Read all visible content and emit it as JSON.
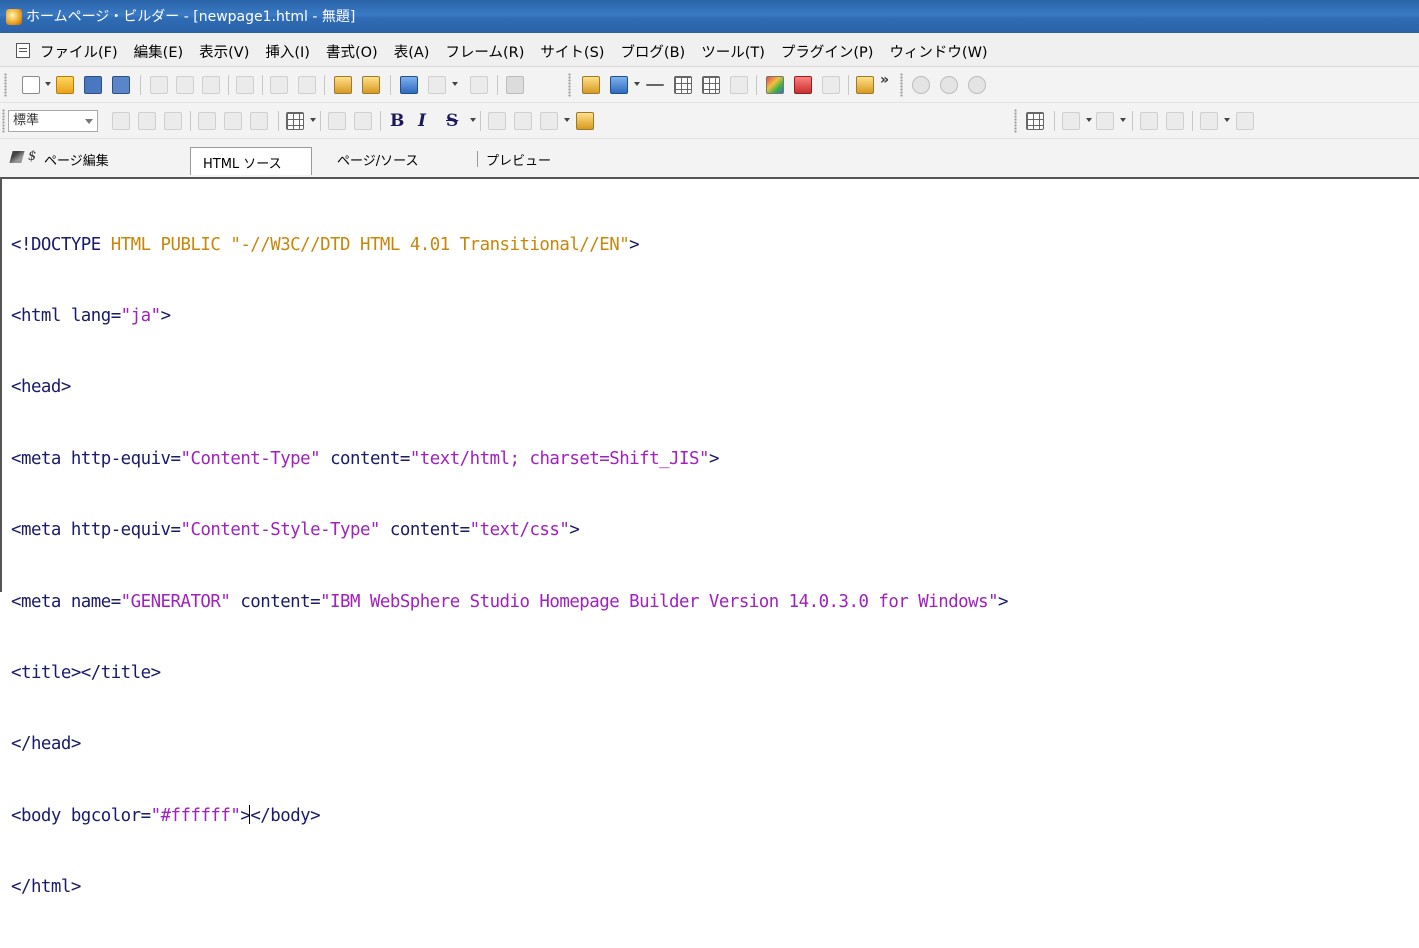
{
  "window": {
    "title": "ホームページ・ビルダー - [newpage1.html - 無題]"
  },
  "menu": {
    "items": [
      "ファイル(F)",
      "編集(E)",
      "表示(V)",
      "挿入(I)",
      "書式(O)",
      "表(A)",
      "フレーム(R)",
      "サイト(S)",
      "ブログ(B)",
      "ツール(T)",
      "プラグイン(P)",
      "ウィンドウ(W)"
    ]
  },
  "toolbar2": {
    "style_select_value": "標準",
    "bold_label": "B",
    "italic_label": "I",
    "strike_label": "S"
  },
  "view_tabs": {
    "page_edit": "ページ編集",
    "html_source": "HTML ソース",
    "page_source": "ページ/ソース",
    "preview": "プレビュー"
  },
  "source": {
    "line1": {
      "a": "<!DOCTYPE",
      "b": " HTML PUBLIC ",
      "c": "\"-//W3C//DTD HTML 4.01 Transitional//EN\"",
      "d": ">"
    },
    "line2": {
      "a": "<html lang=",
      "b": "\"ja\"",
      "c": ">"
    },
    "line3": {
      "a": "<head>"
    },
    "line4": {
      "a": "<meta http-equiv=",
      "b": "\"Content-Type\"",
      "c": " content=",
      "d": "\"text/html; charset=Shift_JIS\"",
      "e": ">"
    },
    "line5": {
      "a": "<meta http-equiv=",
      "b": "\"Content-Style-Type\"",
      "c": " content=",
      "d": "\"text/css\"",
      "e": ">"
    },
    "line6": {
      "a": "<meta name=",
      "b": "\"GENERATOR\"",
      "c": " content=",
      "d": "\"IBM WebSphere Studio Homepage Builder Version 14.0.3.0 for Windows\"",
      "e": ">"
    },
    "line7": {
      "a": "<title></title>"
    },
    "line8": {
      "a": "</head>"
    },
    "line9": {
      "a": "<body bgcolor=",
      "b": "\"#ffffff\"",
      "c": ">",
      "d": "</body>"
    },
    "line10": {
      "a": "</html>"
    }
  },
  "colors": {
    "titlebar": "#2a63a8",
    "tag": "#1a1a6a",
    "doctype": "#c8860a",
    "attribute_value": "#a020c0"
  }
}
